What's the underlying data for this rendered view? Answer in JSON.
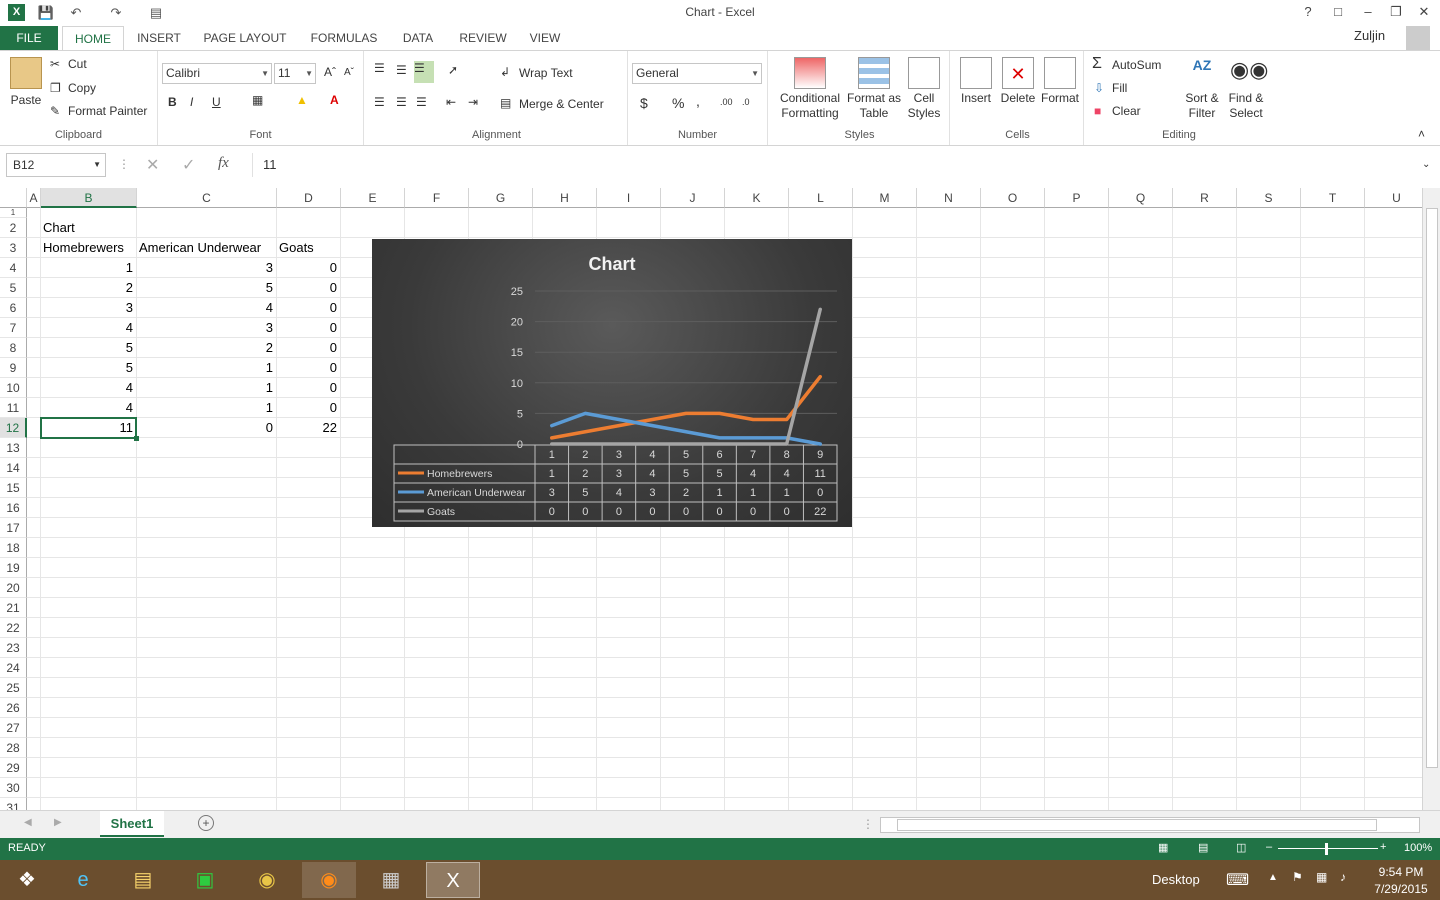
{
  "window": {
    "title": "Chart - Excel",
    "user": "Zuljin"
  },
  "tabs": [
    "FILE",
    "HOME",
    "INSERT",
    "PAGE LAYOUT",
    "FORMULAS",
    "DATA",
    "REVIEW",
    "VIEW"
  ],
  "ribbon": {
    "clipboard": {
      "paste": "Paste",
      "cut": "Cut",
      "copy": "Copy",
      "format_painter": "Format Painter",
      "label": "Clipboard"
    },
    "font": {
      "name": "Calibri",
      "size": "11",
      "bold": "B",
      "italic": "I",
      "underline": "U",
      "label": "Font"
    },
    "alignment": {
      "wrap": "Wrap Text",
      "merge": "Merge & Center",
      "label": "Alignment"
    },
    "number": {
      "format": "General",
      "currency": "$",
      "percent": "%",
      "comma": ",",
      "label": "Number"
    },
    "styles": {
      "conditional": "Conditional",
      "conditional2": "Formatting",
      "format_table": "Format as",
      "format_table2": "Table",
      "cell_styles": "Cell",
      "cell_styles2": "Styles",
      "label": "Styles"
    },
    "cells": {
      "insert": "Insert",
      "delete": "Delete",
      "format": "Format",
      "label": "Cells"
    },
    "editing": {
      "autosum": "AutoSum",
      "fill": "Fill",
      "clear": "Clear",
      "sort": "Sort &",
      "sort2": "Filter",
      "find": "Find &",
      "find2": "Select",
      "label": "Editing"
    }
  },
  "formula_bar": {
    "name_box": "B12",
    "fx": "fx",
    "value": "11"
  },
  "columns": [
    "A",
    "B",
    "C",
    "D",
    "E",
    "F",
    "G",
    "H",
    "I",
    "J",
    "K",
    "L",
    "M",
    "N",
    "O",
    "P",
    "Q",
    "R",
    "S",
    "T",
    "U"
  ],
  "rows": [
    "1",
    "2",
    "3",
    "4",
    "5",
    "6",
    "7",
    "8",
    "9",
    "10",
    "11",
    "12",
    "13",
    "14",
    "15",
    "16",
    "17",
    "18",
    "19",
    "20",
    "21",
    "22",
    "23",
    "24",
    "25",
    "26",
    "27",
    "28",
    "29",
    "30",
    "31"
  ],
  "sheet": {
    "title_cell": "Chart",
    "headers": [
      "Homebrewers",
      "American Underwear",
      "Goats"
    ],
    "data": [
      [
        "1",
        "3",
        "0"
      ],
      [
        "2",
        "5",
        "0"
      ],
      [
        "3",
        "4",
        "0"
      ],
      [
        "4",
        "3",
        "0"
      ],
      [
        "5",
        "2",
        "0"
      ],
      [
        "5",
        "1",
        "0"
      ],
      [
        "4",
        "1",
        "0"
      ],
      [
        "4",
        "1",
        "0"
      ],
      [
        "11",
        "0",
        "22"
      ]
    ]
  },
  "chart_data": {
    "type": "line",
    "title": "Chart",
    "categories": [
      "1",
      "2",
      "3",
      "4",
      "5",
      "6",
      "7",
      "8",
      "9"
    ],
    "series": [
      {
        "name": "Homebrewers",
        "values": [
          1,
          2,
          3,
          4,
          5,
          5,
          4,
          4,
          11
        ],
        "color": "#ed7d31"
      },
      {
        "name": "American Underwear",
        "values": [
          3,
          5,
          4,
          3,
          2,
          1,
          1,
          1,
          0
        ],
        "color": "#5b9bd5"
      },
      {
        "name": "Goats",
        "values": [
          0,
          0,
          0,
          0,
          0,
          0,
          0,
          0,
          22
        ],
        "color": "#a5a5a5"
      }
    ],
    "yticks": [
      "0",
      "5",
      "10",
      "15",
      "20",
      "25"
    ],
    "ylim": [
      0,
      25
    ],
    "data_table": true
  },
  "sheet_tab": "Sheet1",
  "status": {
    "ready": "READY",
    "zoom": "100%"
  },
  "taskbar": {
    "desktop": "Desktop",
    "time": "9:54 PM",
    "date": "7/29/2015"
  }
}
